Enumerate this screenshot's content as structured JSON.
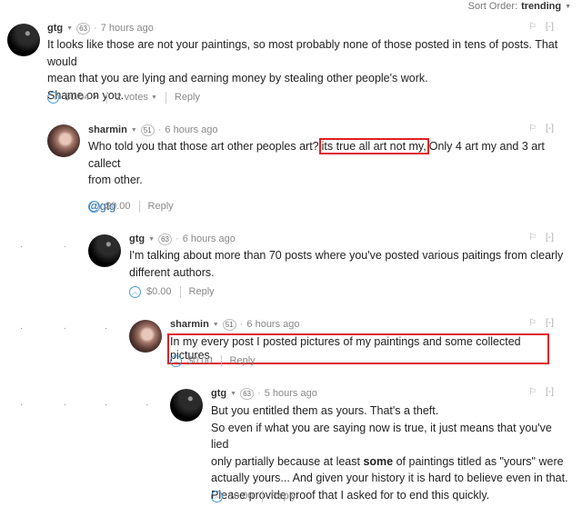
{
  "sort": {
    "label": "Sort Order:",
    "value": "trending"
  },
  "comments": [
    {
      "author": "gtg",
      "rep": "63",
      "time": "7 hours ago",
      "lines": [
        "It looks like those are not your paintings, so most probably none of those posted in tens of posts. That would",
        "mean that you are lying and earning money by stealing other people's work.",
        "Shame on you."
      ],
      "payout": "$0.04",
      "votes": "2 votes",
      "reply": "Reply",
      "flag": "⚐",
      "collapse": "[-]"
    },
    {
      "author": "sharmin",
      "rep": "51",
      "time": "6 hours ago",
      "line1_pre": "Who told you that those art other peoples art?",
      "line1_hl": "its true all art not my,",
      "line1_post": "Only 4 art my and 3 art callect",
      "line2": "from other.",
      "mention": "@gtg",
      "payout": "$0.00",
      "reply": "Reply",
      "flag": "⚐",
      "collapse": "[-]"
    },
    {
      "author": "gtg",
      "rep": "63",
      "time": "6 hours ago",
      "lines": [
        "I'm talking about more than 70 posts where you've posted various paitings from clearly",
        "different authors."
      ],
      "payout": "$0.00",
      "reply": "Reply",
      "flag": "⚐",
      "collapse": "[-]"
    },
    {
      "author": "sharmin",
      "rep": "51",
      "time": "6 hours ago",
      "hl_line": "In my every post I posted pictures of my paintings and some collected pictures.",
      "payout": "$0.00",
      "reply": "Reply",
      "flag": "⚐",
      "collapse": "[-]"
    },
    {
      "author": "gtg",
      "rep": "63",
      "time": "5 hours ago",
      "l1": "But you entitled them as yours. That's a theft.",
      "l2": "So even if what you are saying now is true, it just means that you've lied",
      "l3_pre": "only partially because at least ",
      "l3_bold": "some",
      "l3_post": " of paintings titled as \"yours\" were",
      "l4": "actually yours... And given your history it is hard to believe even in that.",
      "l5": "Please provide proof that I asked for to end this quickly.",
      "payout": "$0.00",
      "reply": "Reply",
      "flag": "⚐",
      "collapse": "[-]"
    }
  ]
}
